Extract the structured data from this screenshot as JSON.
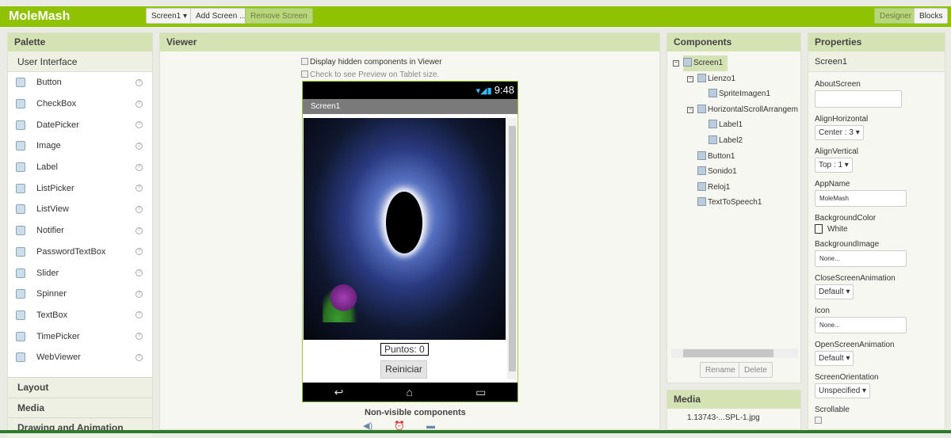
{
  "app": {
    "title": "MoleMash"
  },
  "toolbar": {
    "screen_select": "Screen1 ▾",
    "add_screen": "Add Screen ...",
    "remove_screen": "Remove Screen",
    "designer": "Designer",
    "blocks": "Blocks"
  },
  "palette": {
    "title": "Palette",
    "section": "User Interface",
    "help": "?",
    "items": [
      {
        "label": "Button"
      },
      {
        "label": "CheckBox"
      },
      {
        "label": "DatePicker"
      },
      {
        "label": "Image"
      },
      {
        "label": "Label"
      },
      {
        "label": "ListPicker"
      },
      {
        "label": "ListView"
      },
      {
        "label": "Notifier"
      },
      {
        "label": "PasswordTextBox"
      },
      {
        "label": "Slider"
      },
      {
        "label": "Spinner"
      },
      {
        "label": "TextBox"
      },
      {
        "label": "TimePicker"
      },
      {
        "label": "WebViewer"
      }
    ],
    "categories": [
      "Layout",
      "Media",
      "Drawing and Animation"
    ]
  },
  "viewer": {
    "title": "Viewer",
    "display_hidden": "Display hidden components in Viewer",
    "tablet_preview": "Check to see Preview on Tablet size.",
    "phone": {
      "time": "9:48",
      "screen_title": "Screen1",
      "label_text": "Puntos:   0",
      "button_text": "Reiniciar"
    },
    "nonvisible_title": "Non-visible components"
  },
  "components": {
    "title": "Components",
    "tree": [
      {
        "label": "Screen1",
        "level": 0
      },
      {
        "label": "Lienzo1",
        "level": 1
      },
      {
        "label": "SpriteImagen1",
        "level": 2
      },
      {
        "label": "HorizontalScrollArrangem",
        "level": 1
      },
      {
        "label": "Label1",
        "level": 2
      },
      {
        "label": "Label2",
        "level": 2
      },
      {
        "label": "Button1",
        "level": 1
      },
      {
        "label": "Sonido1",
        "level": 1
      },
      {
        "label": "Reloj1",
        "level": 1
      },
      {
        "label": "TextToSpeech1",
        "level": 1
      }
    ],
    "rename": "Rename",
    "delete": "Delete"
  },
  "media": {
    "title": "Media",
    "items": [
      "1.13743-...SPL-1.jpg"
    ]
  },
  "properties": {
    "title": "Properties",
    "component": "Screen1",
    "about_label": "AboutScreen",
    "align_h_label": "AlignHorizontal",
    "align_h": "Center : 3 ▾",
    "align_v_label": "AlignVertical",
    "align_v": "Top : 1 ▾",
    "appname_label": "AppName",
    "appname": "MoleMash",
    "bgcolor_label": "BackgroundColor",
    "bgcolor": "White",
    "bgimage_label": "BackgroundImage",
    "bgimage": "None...",
    "close_anim_label": "CloseScreenAnimation",
    "close_anim": "Default ▾",
    "icon_label": "Icon",
    "icon": "None...",
    "open_anim_label": "OpenScreenAnimation",
    "open_anim": "Default ▾",
    "orientation_label": "ScreenOrientation",
    "orientation": "Unspecified ▾",
    "scrollable_label": "Scrollable"
  }
}
